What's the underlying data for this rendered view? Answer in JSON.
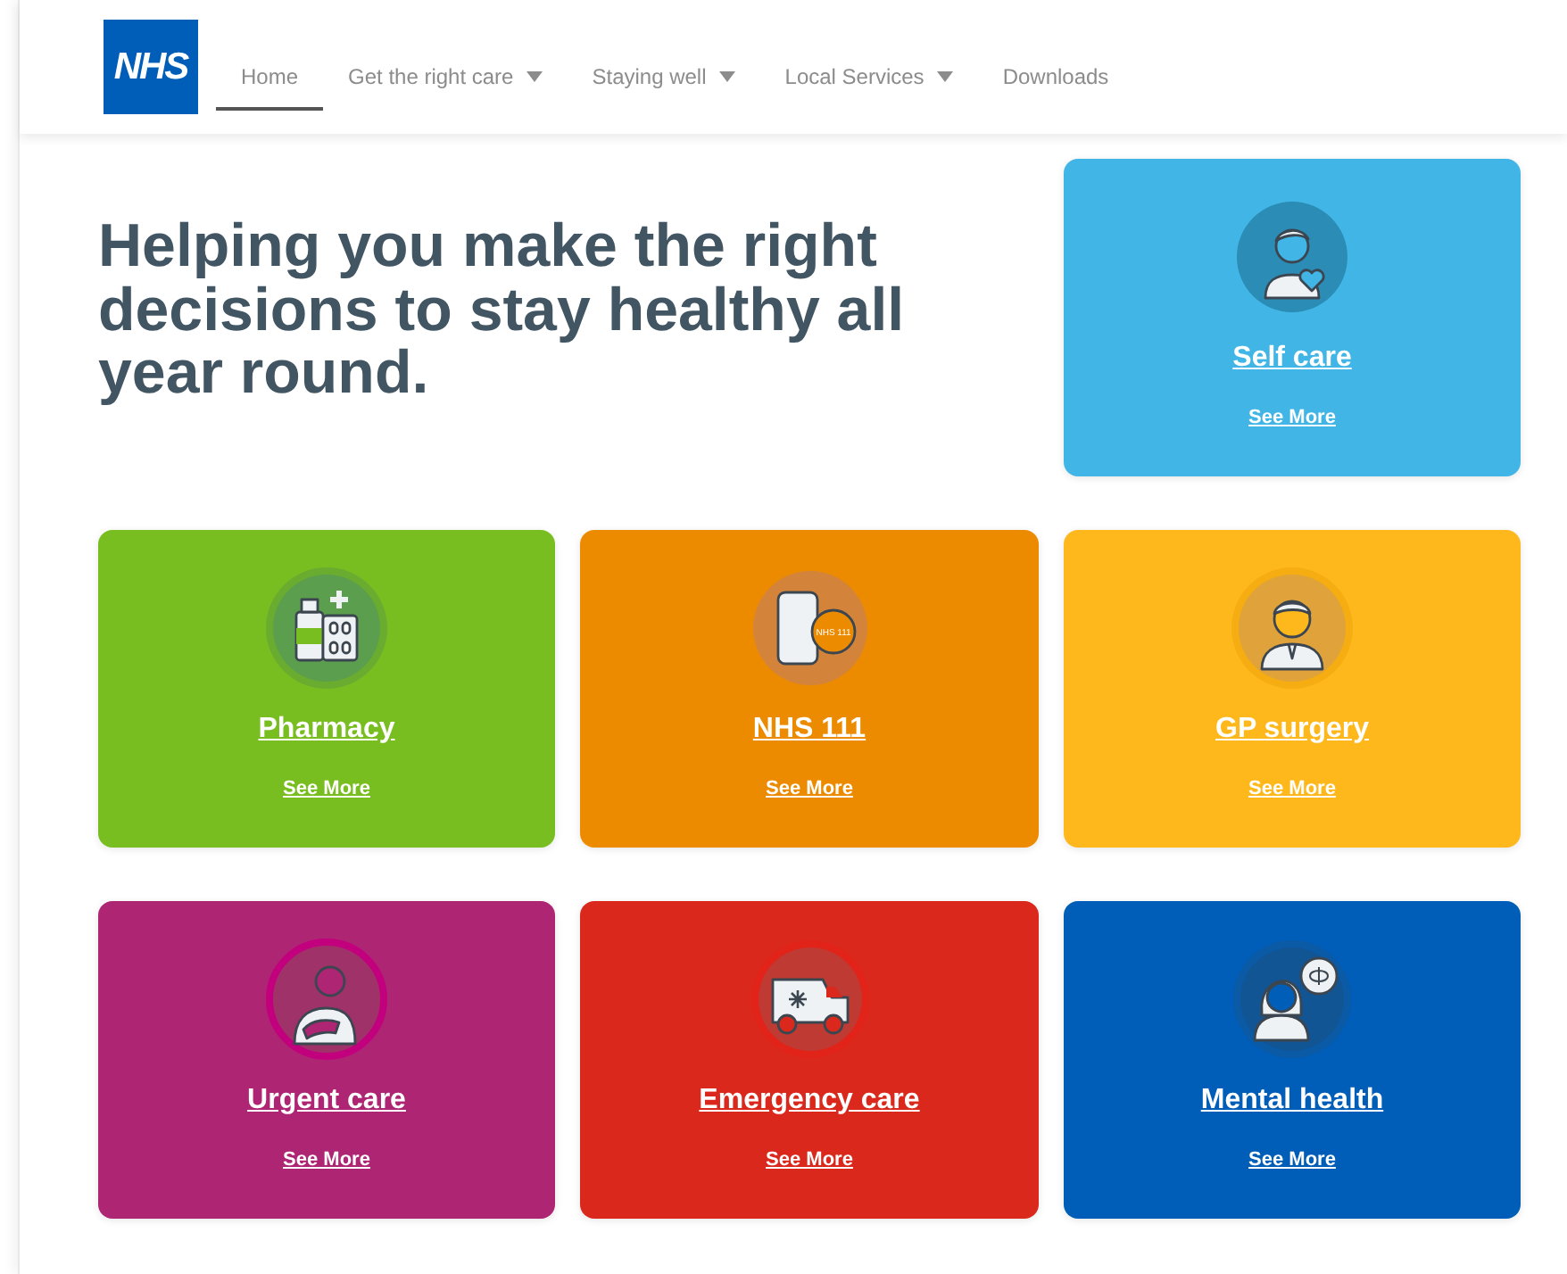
{
  "logo": {
    "text": "NHS"
  },
  "nav": [
    {
      "label": "Home",
      "selected": true,
      "dropdown": false
    },
    {
      "label": "Get the right care",
      "selected": false,
      "dropdown": true
    },
    {
      "label": "Staying well",
      "selected": false,
      "dropdown": true
    },
    {
      "label": "Local Services",
      "selected": false,
      "dropdown": true
    },
    {
      "label": "Downloads",
      "selected": false,
      "dropdown": false
    }
  ],
  "heading": "Helping you make the right decisions to stay healthy all year round.",
  "cards": [
    {
      "title": "Self care",
      "link": "See More",
      "color": "#41b6e6",
      "kind": "self-care"
    },
    {
      "title": "Pharmacy",
      "link": "See More",
      "color": "#78be20",
      "kind": "pharmacy"
    },
    {
      "title": "NHS 111",
      "link": "See More",
      "color": "#ed8b00",
      "kind": "phone",
      "icon_text": "NHS 111"
    },
    {
      "title": "GP surgery",
      "link": "See More",
      "color": "#ffb81c",
      "kind": "doctor"
    },
    {
      "title": "Urgent care",
      "link": "See More",
      "color": "#ae2573",
      "kind": "urgent"
    },
    {
      "title": "Emergency care",
      "link": "See More",
      "color": "#da291c",
      "kind": "ambulance"
    },
    {
      "title": "Mental health",
      "link": "See More",
      "color": "#005eb8",
      "kind": "mental"
    }
  ]
}
